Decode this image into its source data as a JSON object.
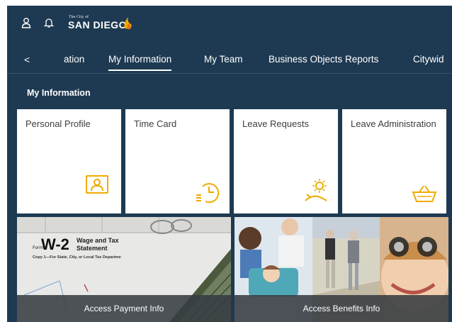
{
  "brand": {
    "small": "The City of",
    "name": "SAN DIEGO"
  },
  "header": {
    "icons": [
      "user-icon",
      "bell-icon"
    ],
    "accent": "#f0ab00"
  },
  "tabs": {
    "back": "<",
    "items": [
      {
        "label": "ation"
      },
      {
        "label": "My Information",
        "active": true
      },
      {
        "label": "My Team"
      },
      {
        "label": "Business Objects Reports"
      },
      {
        "label": "Citywid"
      }
    ]
  },
  "section": {
    "title": "My Information"
  },
  "tiles": [
    {
      "title": "Personal Profile",
      "icon": "profile-card-icon"
    },
    {
      "title": "Time Card",
      "icon": "clock-list-icon"
    },
    {
      "title": "Leave Requests",
      "icon": "beach-sun-icon"
    },
    {
      "title": "Leave Administration",
      "icon": "basket-icon"
    }
  ],
  "image_tiles": [
    {
      "caption": "Access Payment Info",
      "image": "w2-form-image",
      "form_word": "Form",
      "form_code": "W-2",
      "form_title_1": "Wage and Tax",
      "form_title_2": "Statement",
      "form_copy": "Copy 1—For State, City, or Local Tax Departme"
    },
    {
      "caption": "Access Benefits Info",
      "image": "benefits-collage-image"
    }
  ],
  "colors": {
    "background": "#1e3a52",
    "tile": "#ffffff",
    "icon": "#f0ab00",
    "caption_bg": "#373c42"
  }
}
